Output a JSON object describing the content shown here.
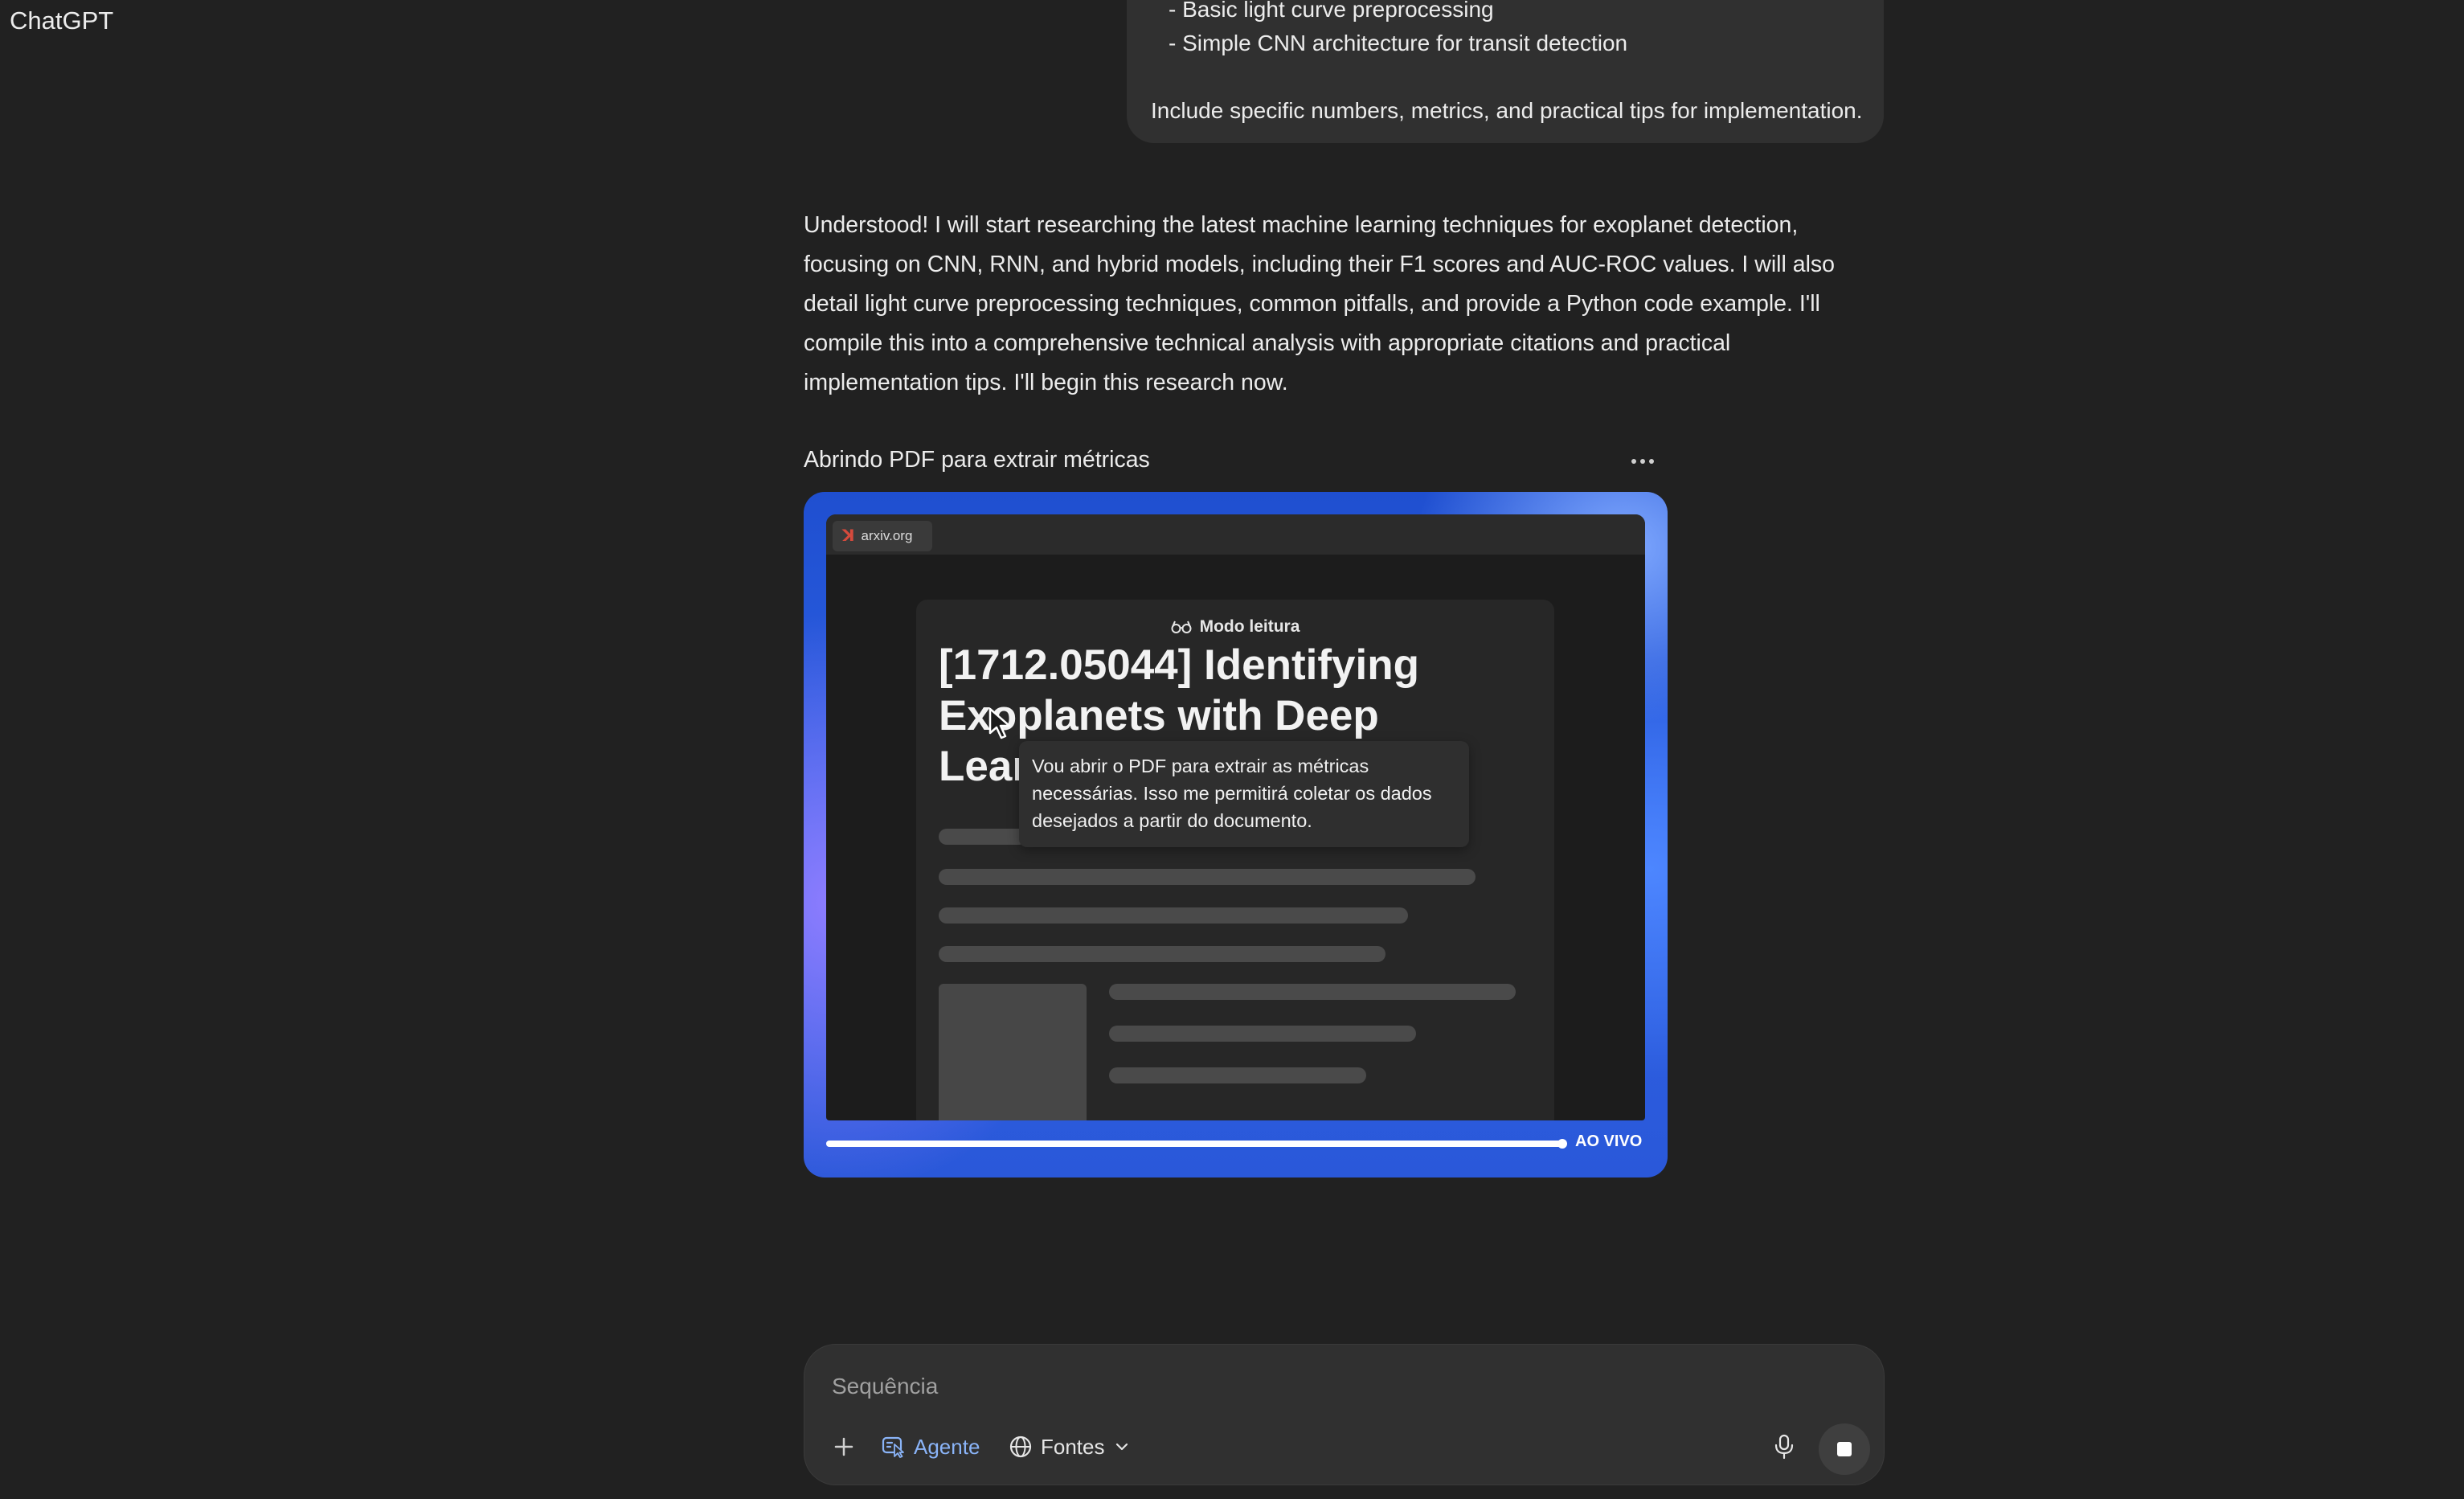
{
  "app": {
    "title": "ChatGPT"
  },
  "user_message": {
    "lines": [
      "- Basic light curve preprocessing",
      "- Simple CNN architecture for transit detection",
      "",
      "Include specific numbers, metrics, and practical tips for implementation."
    ]
  },
  "assistant": {
    "text": "Understood! I will start researching the latest machine learning techniques for exoplanet detection, focusing on CNN, RNN, and hybrid models, including their F1 scores and AUC-ROC values. I will also detail light curve preprocessing techniques, common pitfalls, and provide a Python code example. I'll compile this into a comprehensive technical analysis with appropriate citations and practical implementation tips. I'll begin this research now.",
    "activity_title": "Abrindo PDF para extrair métricas"
  },
  "browser": {
    "tab_label": "arxiv.org",
    "reader_mode_label": "Modo leitura",
    "paper_title": "[1712.05044] Identifying Exoplanets with Deep Learning",
    "tooltip": "Vou abrir o PDF para extrair as métricas necessárias. Isso me permitirá coletar os dados desejados a partir do documento.",
    "live_label": "AO VIVO",
    "progress": 1.0
  },
  "composer": {
    "placeholder": "Sequência",
    "agent_label": "Agente",
    "sources_label": "Fontes"
  },
  "colors": {
    "background": "#212121",
    "bubble": "#303030",
    "agent_accent": "#8ab4f8",
    "live_card_blue": "#2f63e6"
  },
  "icons": [
    "more-icon",
    "arxiv-icon",
    "reading-glasses-icon",
    "cursor-icon",
    "plus-icon",
    "agent-icon",
    "globe-icon",
    "chevron-down-icon",
    "microphone-icon",
    "stop-icon"
  ]
}
